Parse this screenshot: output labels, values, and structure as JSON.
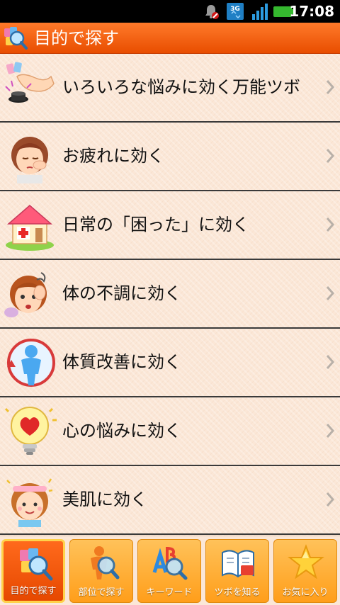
{
  "status_bar": {
    "time": "17:08",
    "network": "3G",
    "icons": [
      "notification-muted-icon",
      "3g-icon",
      "signal-icon",
      "battery-icon"
    ]
  },
  "header": {
    "title": "目的で探す",
    "icon": "search-magnifier-icon",
    "background": "#f05a10"
  },
  "list": {
    "items": [
      {
        "label": "いろいろな悩みに効く万能ツボ",
        "icon": "hand-magic-icon"
      },
      {
        "label": "お疲れに効く",
        "icon": "tired-person-icon"
      },
      {
        "label": "日常の「困った」に効く",
        "icon": "first-aid-house-icon"
      },
      {
        "label": "体の不調に効く",
        "icon": "dizzy-person-icon"
      },
      {
        "label": "体質改善に効く",
        "icon": "body-cycle-icon"
      },
      {
        "label": "心の悩みに効く",
        "icon": "heart-bulb-icon"
      },
      {
        "label": "美肌に効く",
        "icon": "smiling-girl-icon"
      }
    ]
  },
  "bottom_nav": {
    "items": [
      {
        "label": "目的で探す",
        "icon": "search-by-purpose-icon",
        "active": true
      },
      {
        "label": "部位で探す",
        "icon": "search-by-body-part-icon",
        "active": false
      },
      {
        "label": "キーワード",
        "icon": "keyword-abc-icon",
        "active": false
      },
      {
        "label": "ツボを知る",
        "icon": "book-icon",
        "active": false
      },
      {
        "label": "お気に入り",
        "icon": "star-icon",
        "active": false
      }
    ]
  }
}
